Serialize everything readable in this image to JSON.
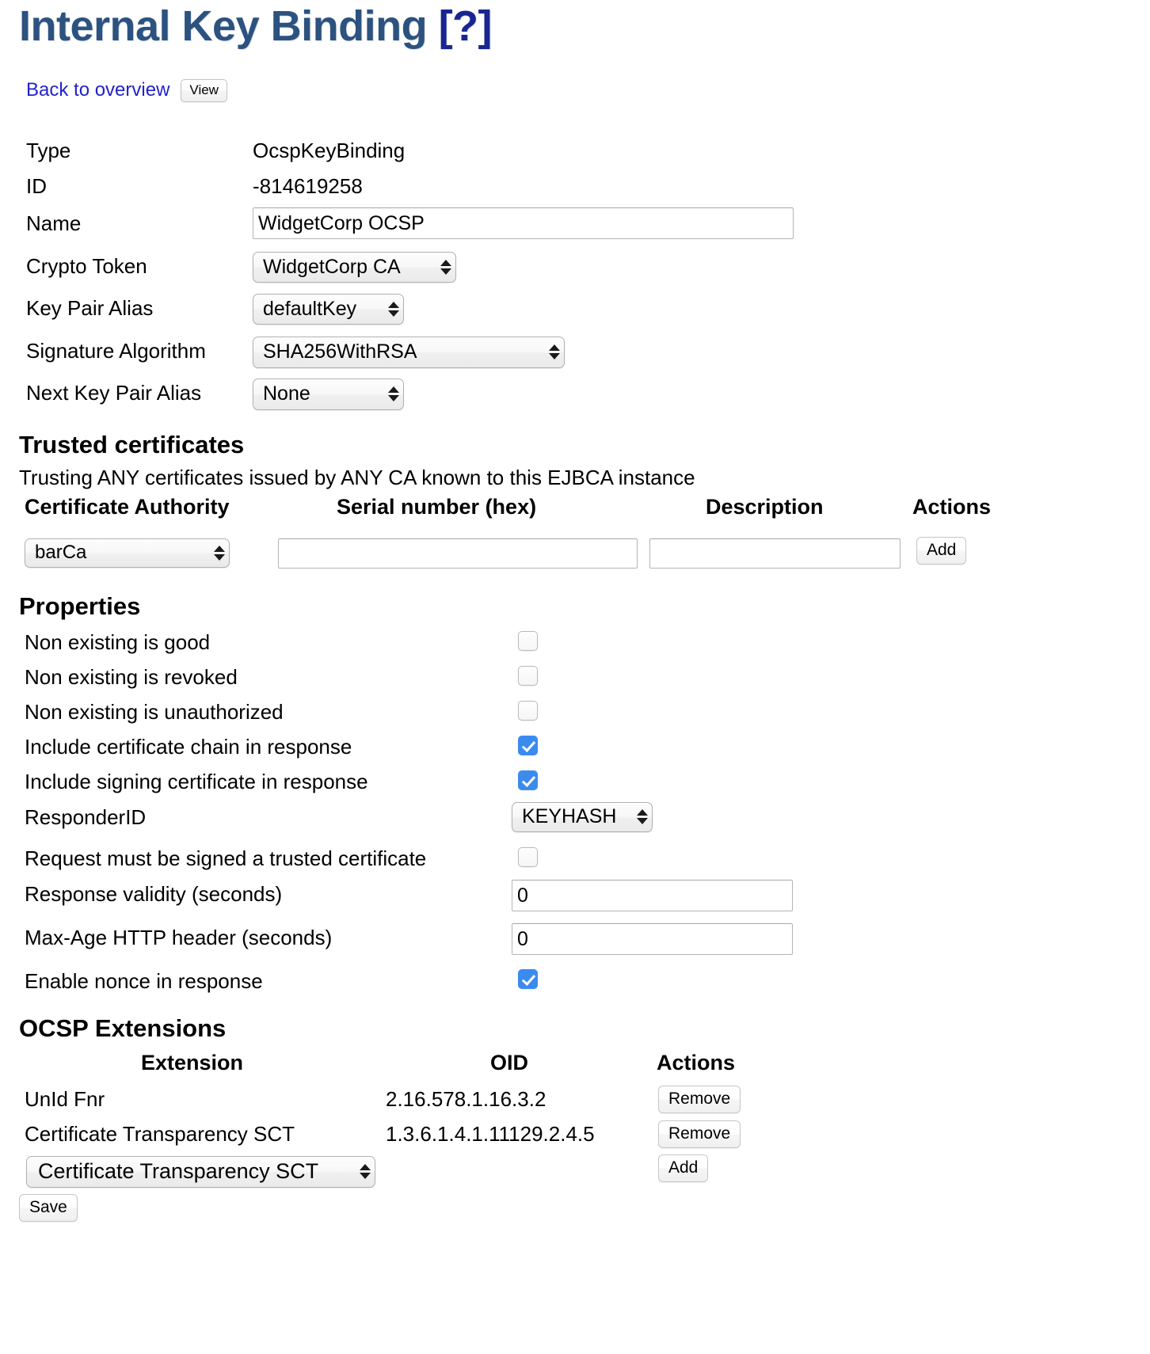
{
  "header": {
    "title": "Internal Key Binding",
    "help_marker": "[?]",
    "back_link": "Back to overview",
    "view_button": "View"
  },
  "details": {
    "type_label": "Type",
    "type_value": "OcspKeyBinding",
    "id_label": "ID",
    "id_value": "-814619258",
    "name_label": "Name",
    "name_value": "WidgetCorp OCSP",
    "crypto_token_label": "Crypto Token",
    "crypto_token_value": "WidgetCorp CA",
    "key_pair_alias_label": "Key Pair Alias",
    "key_pair_alias_value": "defaultKey",
    "signature_algorithm_label": "Signature Algorithm",
    "signature_algorithm_value": "SHA256WithRSA",
    "next_key_pair_alias_label": "Next Key Pair Alias",
    "next_key_pair_alias_value": "None"
  },
  "trusted_certificates": {
    "heading": "Trusted certificates",
    "note": "Trusting ANY certificates issued by ANY CA known to this EJBCA instance",
    "columns": {
      "ca": "Certificate Authority",
      "serial": "Serial number (hex)",
      "description": "Description",
      "actions": "Actions"
    },
    "row": {
      "ca_value": "barCa",
      "serial_value": "",
      "serial_placeholder": "",
      "description_value": "",
      "description_placeholder": "",
      "add_button": "Add"
    }
  },
  "properties": {
    "heading": "Properties",
    "items": [
      {
        "label": "Non existing is good",
        "checked": false
      },
      {
        "label": "Non existing is revoked",
        "checked": false
      },
      {
        "label": "Non existing is unauthorized",
        "checked": false
      },
      {
        "label": "Include certificate chain in response",
        "checked": true
      },
      {
        "label": "Include signing certificate in response",
        "checked": true
      }
    ],
    "responder_id_label": "ResponderID",
    "responder_id_value": "KEYHASH",
    "request_signed_label": "Request must be signed a trusted certificate",
    "request_signed_checked": false,
    "response_validity_label": "Response validity (seconds)",
    "response_validity_value": "0",
    "max_age_label": "Max-Age HTTP header (seconds)",
    "max_age_value": "0",
    "nonce_label": "Enable nonce in response",
    "nonce_checked": true
  },
  "ocsp_extensions": {
    "heading": "OCSP Extensions",
    "columns": {
      "extension": "Extension",
      "oid": "OID",
      "actions": "Actions"
    },
    "rows": [
      {
        "extension": "UnId Fnr",
        "oid": "2.16.578.1.16.3.2",
        "action": "Remove"
      },
      {
        "extension": "Certificate Transparency SCT",
        "oid": "1.3.6.1.4.1.11129.2.4.5",
        "action": "Remove"
      }
    ],
    "new_extension_value": "Certificate Transparency SCT",
    "add_button": "Add"
  },
  "footer": {
    "save_button": "Save"
  },
  "colors": {
    "title": "#2c527f",
    "help_marker": "#19268f",
    "link": "#2222cc",
    "checkbox_on": "#3b8bee"
  }
}
